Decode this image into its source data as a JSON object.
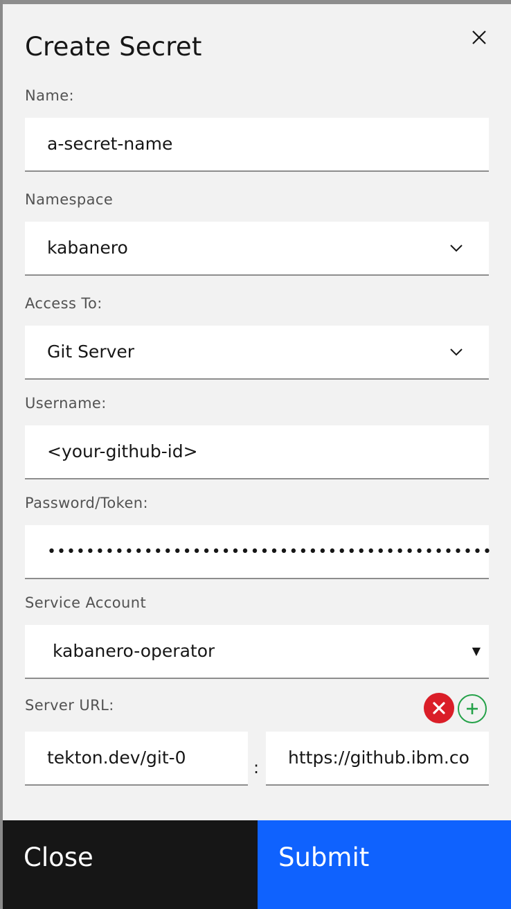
{
  "modal": {
    "title": "Create Secret"
  },
  "fields": {
    "name": {
      "label": "Name:",
      "value": "a-secret-name"
    },
    "namespace": {
      "label": "Namespace",
      "value": "kabanero"
    },
    "access_to": {
      "label": "Access To:",
      "value": "Git Server"
    },
    "username": {
      "label": "Username:",
      "value": "<your-github-id>"
    },
    "password": {
      "label": "Password/Token:",
      "value": "••••••••••••••••••••••••••••••••••••••••••••••"
    },
    "service_account": {
      "label": "Service Account",
      "value": "kabanero-operator"
    },
    "server_url": {
      "label": "Server URL:",
      "key": "tekton.dev/git-0",
      "separator": ":",
      "value": "https://github.ibm.co"
    }
  },
  "footer": {
    "close_label": "Close",
    "submit_label": "Submit"
  },
  "colors": {
    "primary": "#0f62fe",
    "danger": "#da1e28",
    "success": "#24a148",
    "dark": "#161616"
  },
  "icons": {
    "close": "close-icon",
    "chevron": "chevron-down-icon",
    "caret": "caret-down-icon",
    "remove": "remove-circle-icon",
    "add": "add-circle-icon"
  }
}
